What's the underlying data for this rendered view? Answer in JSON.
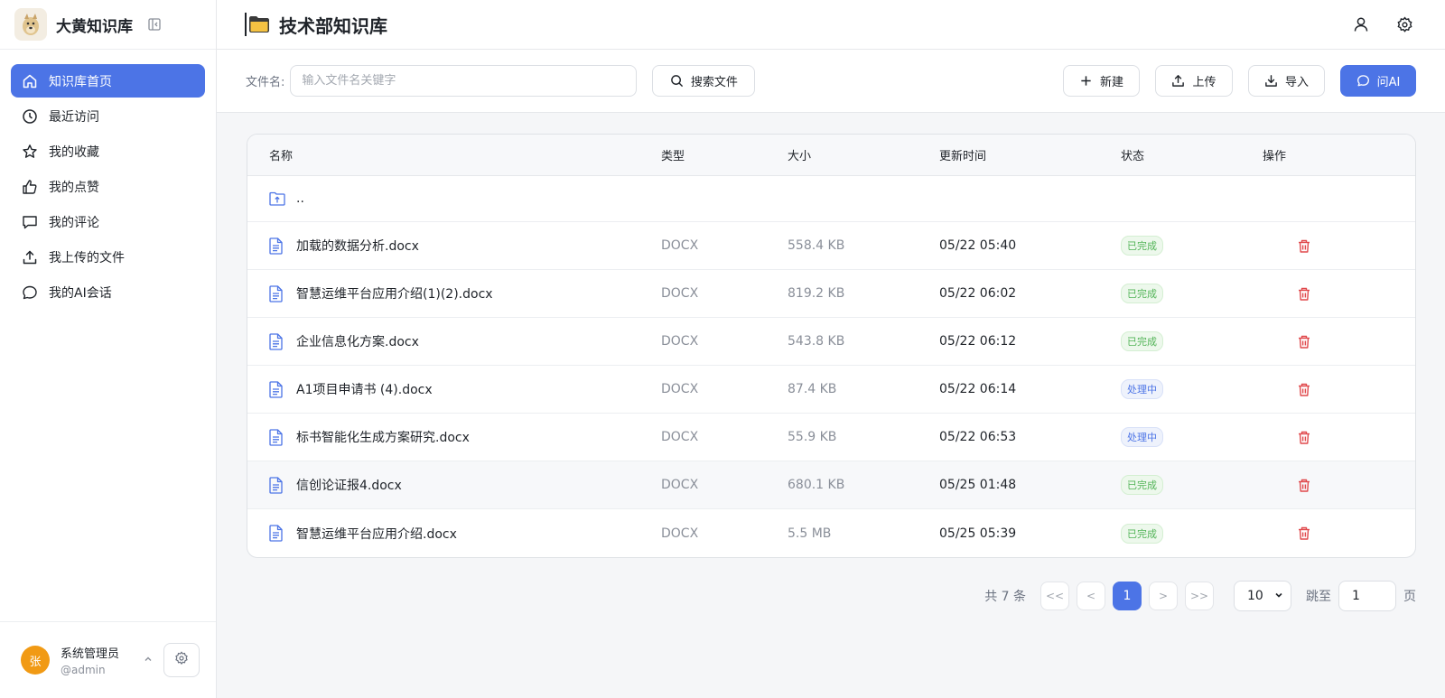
{
  "app": {
    "name": "大黄知识库"
  },
  "sidebar": {
    "items": [
      {
        "label": "知识库首页",
        "icon": "home-icon",
        "active": true
      },
      {
        "label": "最近访问",
        "icon": "clock-icon"
      },
      {
        "label": "我的收藏",
        "icon": "star-icon"
      },
      {
        "label": "我的点赞",
        "icon": "thumbs-up-icon"
      },
      {
        "label": "我的评论",
        "icon": "comment-icon"
      },
      {
        "label": "我上传的文件",
        "icon": "upload-icon"
      },
      {
        "label": "我的AI会话",
        "icon": "chat-icon"
      }
    ],
    "user": {
      "avatar_text": "张",
      "name": "系统管理员",
      "handle": "@admin"
    }
  },
  "header": {
    "title": "技术部知识库"
  },
  "toolbar": {
    "filename_label": "文件名:",
    "search_placeholder": "输入文件名关键字",
    "search_button": "搜索文件",
    "new_button": "新建",
    "upload_button": "上传",
    "import_button": "导入",
    "ai_button": "问AI"
  },
  "table": {
    "columns": {
      "name": "名称",
      "type": "类型",
      "size": "大小",
      "updated": "更新时间",
      "status": "状态",
      "actions": "操作"
    },
    "parent_row": "..",
    "rows": [
      {
        "name": "加载的数据分析.docx",
        "type": "DOCX",
        "size": "558.4 KB",
        "updated": "05/22 05:40",
        "status": "已完成",
        "status_kind": "done"
      },
      {
        "name": "智慧运维平台应用介绍(1)(2).docx",
        "type": "DOCX",
        "size": "819.2 KB",
        "updated": "05/22 06:02",
        "status": "已完成",
        "status_kind": "done"
      },
      {
        "name": "企业信息化方案.docx",
        "type": "DOCX",
        "size": "543.8 KB",
        "updated": "05/22 06:12",
        "status": "已完成",
        "status_kind": "done"
      },
      {
        "name": "A1项目申请书 (4).docx",
        "type": "DOCX",
        "size": "87.4 KB",
        "updated": "05/22 06:14",
        "status": "处理中",
        "status_kind": "processing"
      },
      {
        "name": "标书智能化生成方案研究.docx",
        "type": "DOCX",
        "size": "55.9 KB",
        "updated": "05/22 06:53",
        "status": "处理中",
        "status_kind": "processing"
      },
      {
        "name": "信创论证报4.docx",
        "type": "DOCX",
        "size": "680.1 KB",
        "updated": "05/25 01:48",
        "status": "已完成",
        "status_kind": "done"
      },
      {
        "name": "智慧运维平台应用介绍.docx",
        "type": "DOCX",
        "size": "5.5 MB",
        "updated": "05/25 05:39",
        "status": "已完成",
        "status_kind": "done"
      }
    ]
  },
  "pagination": {
    "total_text": "共 7 条",
    "first": "<<",
    "prev": "<",
    "current": "1",
    "next": ">",
    "last": ">>",
    "page_size": "10",
    "jump_label": "跳至",
    "jump_value": "1",
    "page_unit": "页"
  },
  "colors": {
    "accent": "#4c74e6",
    "done": "#52b457",
    "delete": "#e0484b",
    "avatar": "#f19a14"
  }
}
